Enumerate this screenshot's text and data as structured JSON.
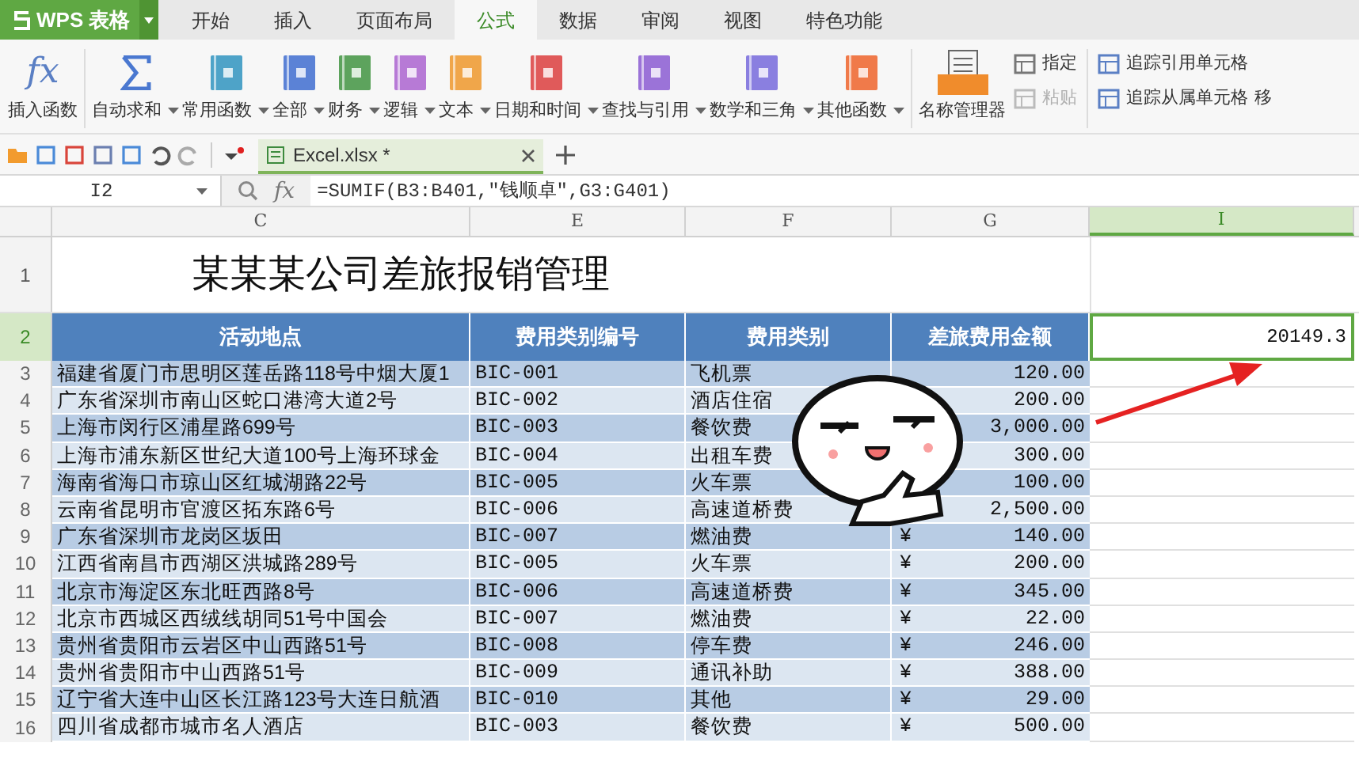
{
  "app": {
    "name": "WPS 表格"
  },
  "ribbon_tabs": [
    {
      "label": "开始",
      "selected": false
    },
    {
      "label": "插入",
      "selected": false
    },
    {
      "label": "页面布局",
      "selected": false
    },
    {
      "label": "公式",
      "selected": true
    },
    {
      "label": "数据",
      "selected": false
    },
    {
      "label": "审阅",
      "selected": false
    },
    {
      "label": "视图",
      "selected": false
    },
    {
      "label": "特色功能",
      "selected": false
    }
  ],
  "ribbon_buttons": [
    {
      "label": "插入函数",
      "dropdown": false,
      "icon_text": "fx"
    },
    {
      "label": "自动求和",
      "dropdown": true
    },
    {
      "label": "常用函数",
      "dropdown": true
    },
    {
      "label": "全部",
      "dropdown": true
    },
    {
      "label": "财务",
      "dropdown": true
    },
    {
      "label": "逻辑",
      "dropdown": true
    },
    {
      "label": "文本",
      "dropdown": true
    },
    {
      "label": "日期和时间",
      "dropdown": true
    },
    {
      "label": "查找与引用",
      "dropdown": true
    },
    {
      "label": "数学和三角",
      "dropdown": true
    },
    {
      "label": "其他函数",
      "dropdown": true
    },
    {
      "label": "名称管理器",
      "dropdown": false
    }
  ],
  "name_buttons": [
    {
      "label": "指定",
      "disabled": false
    },
    {
      "label": "粘贴",
      "disabled": true
    }
  ],
  "trace_buttons": [
    {
      "label": "追踪引用单元格"
    },
    {
      "label": "追踪从属单元格"
    }
  ],
  "ribbon_overflow": "移",
  "doc_tab": {
    "title": "Excel.xlsx *",
    "selected": true
  },
  "formula_bar": {
    "cell_ref": "I2",
    "fx_text": "fx",
    "formula": "=SUMIF(B3:B401,\"钱顺卓\",G3:G401)"
  },
  "sheet": {
    "columns": [
      {
        "label": "C",
        "selected": false
      },
      {
        "label": "E",
        "selected": false
      },
      {
        "label": "F",
        "selected": false
      },
      {
        "label": "G",
        "selected": false
      },
      {
        "label": "I",
        "selected": true
      }
    ],
    "title_row": {
      "row": "1",
      "selected": false,
      "text": "某某某公司差旅报销管理"
    },
    "header_row": {
      "row": "2",
      "selected": true,
      "cells": [
        "活动地点",
        "费用类别编号",
        "费用类别",
        "差旅费用金额"
      ]
    },
    "selected_cell": {
      "value": "20149.3"
    },
    "rows": [
      {
        "row": "3",
        "location": "福建省厦门市思明区莲岳路118号中烟大厦1",
        "code": "BIC-001",
        "category": "飞机票",
        "amount": "120.00"
      },
      {
        "row": "4",
        "location": "广东省深圳市南山区蛇口港湾大道2号",
        "code": "BIC-002",
        "category": "酒店住宿",
        "amount": "200.00"
      },
      {
        "row": "5",
        "location": "上海市闵行区浦星路699号",
        "code": "BIC-003",
        "category": "餐饮费",
        "amount": "3,000.00"
      },
      {
        "row": "6",
        "location": "上海市浦东新区世纪大道100号上海环球金",
        "code": "BIC-004",
        "category": "出租车费",
        "amount": "300.00"
      },
      {
        "row": "7",
        "location": "海南省海口市琼山区红城湖路22号",
        "code": "BIC-005",
        "category": "火车票",
        "amount": "100.00"
      },
      {
        "row": "8",
        "location": "云南省昆明市官渡区拓东路6号",
        "code": "BIC-006",
        "category": "高速道桥费",
        "amount": "2,500.00"
      },
      {
        "row": "9",
        "location": "广东省深圳市龙岗区坂田",
        "code": "BIC-007",
        "category": "燃油费",
        "currency": "¥",
        "amount": "140.00"
      },
      {
        "row": "10",
        "location": "江西省南昌市西湖区洪城路289号",
        "code": "BIC-005",
        "category": "火车票",
        "currency": "¥",
        "amount": "200.00"
      },
      {
        "row": "11",
        "location": "北京市海淀区东北旺西路8号",
        "code": "BIC-006",
        "category": "高速道桥费",
        "currency": "¥",
        "amount": "345.00"
      },
      {
        "row": "12",
        "location": "北京市西城区西绒线胡同51号中国会",
        "code": "BIC-007",
        "category": "燃油费",
        "currency": "¥",
        "amount": "22.00"
      },
      {
        "row": "13",
        "location": "贵州省贵阳市云岩区中山西路51号",
        "code": "BIC-008",
        "category": "停车费",
        "currency": "¥",
        "amount": "246.00"
      },
      {
        "row": "14",
        "location": "贵州省贵阳市中山西路51号",
        "code": "BIC-009",
        "category": "通讯补助",
        "currency": "¥",
        "amount": "388.00"
      },
      {
        "row": "15",
        "location": "辽宁省大连中山区长江路123号大连日航酒",
        "code": "BIC-010",
        "category": "其他",
        "currency": "¥",
        "amount": "29.00"
      },
      {
        "row": "16",
        "location": "四川省成都市城市名人酒店",
        "code": "BIC-003",
        "category": "餐饮费",
        "currency": "¥",
        "amount": "500.00"
      }
    ]
  }
}
